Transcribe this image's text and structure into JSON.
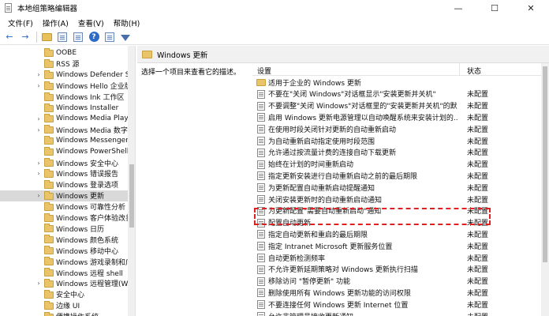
{
  "window": {
    "title": "本地组策略编辑器",
    "controls": [
      "—",
      "☐",
      "✕"
    ]
  },
  "menubar": [
    "文件(F)",
    "操作(A)",
    "查看(V)",
    "帮助(H)"
  ],
  "toolbar": {
    "back_icon": "arrow-left",
    "forward_icon": "arrow-right",
    "help_glyph": "?"
  },
  "tree": {
    "items": [
      {
        "label": "OOBE",
        "expander": ""
      },
      {
        "label": "RSS 源",
        "expander": ""
      },
      {
        "label": "Windows Defender Sr",
        "expander": "›"
      },
      {
        "label": "Windows Hello 企业版",
        "expander": "›"
      },
      {
        "label": "Windows Ink 工作区",
        "expander": ""
      },
      {
        "label": "Windows Installer",
        "expander": ""
      },
      {
        "label": "Windows Media Playe",
        "expander": "›"
      },
      {
        "label": "Windows Media 数字",
        "expander": "›"
      },
      {
        "label": "Windows Messenger",
        "expander": ""
      },
      {
        "label": "Windows PowerShell",
        "expander": ""
      },
      {
        "label": "Windows 安全中心",
        "expander": "›"
      },
      {
        "label": "Windows 错误报告",
        "expander": "›"
      },
      {
        "label": "Windows 登录选项",
        "expander": ""
      },
      {
        "label": "Windows 更新",
        "expander": "›"
      },
      {
        "label": "Windows 可靠性分析",
        "expander": ""
      },
      {
        "label": "Windows 客户体验改善",
        "expander": ""
      },
      {
        "label": "Windows 日历",
        "expander": ""
      },
      {
        "label": "Windows 颜色系统",
        "expander": ""
      },
      {
        "label": "Windows 移动中心",
        "expander": ""
      },
      {
        "label": "Windows 游戏录制和广",
        "expander": ""
      },
      {
        "label": "Windows 远程 shell",
        "expander": ""
      },
      {
        "label": "Windows 远程管理(Wi",
        "expander": "›"
      },
      {
        "label": "安全中心",
        "expander": ""
      },
      {
        "label": "边缘 UI",
        "expander": ""
      },
      {
        "label": "便携操作系统",
        "expander": ""
      }
    ],
    "selected_index": 13
  },
  "breadcrumb": {
    "title": "Windows 更新"
  },
  "description": {
    "text": "选择一个项目来查看它的描述。"
  },
  "list": {
    "col_setting": "设置",
    "col_state": "状态",
    "rows": [
      {
        "name": "适用于企业的 Windows 更新",
        "state": "",
        "type": "folder"
      },
      {
        "name": "不要在\"关闭 Windows\"对话框显示\"安装更新并关机\"",
        "state": "未配置",
        "type": "policy"
      },
      {
        "name": "不要调整\"关闭 Windows\"对话框里的\"安装更新并关机\"的默...",
        "state": "未配置",
        "type": "policy"
      },
      {
        "name": "启用 Windows 更新电源管理以自动唤醒系统来安装计划的...",
        "state": "未配置",
        "type": "policy"
      },
      {
        "name": "在使用时段关闭针对更新的自动重新启动",
        "state": "未配置",
        "type": "policy"
      },
      {
        "name": "为自动重新启动指定使用时段范围",
        "state": "未配置",
        "type": "policy"
      },
      {
        "name": "允许通过按流量计费的连接自动下载更新",
        "state": "未配置",
        "type": "policy"
      },
      {
        "name": "始终在计划的时间重新启动",
        "state": "未配置",
        "type": "policy"
      },
      {
        "name": "指定更新安装进行自动重新启动之前的最后期限",
        "state": "未配置",
        "type": "policy"
      },
      {
        "name": "为更新配置自动重新启动提醒通知",
        "state": "未配置",
        "type": "policy"
      },
      {
        "name": "关闭安装更新时的自动重新启动通知",
        "state": "未配置",
        "type": "policy"
      },
      {
        "name": "为更新配置\"需要自动重新启动\"通知",
        "state": "未配置",
        "type": "policy"
      },
      {
        "name": "配置自动更新",
        "state": "未配置",
        "type": "policy"
      },
      {
        "name": "指定自动更新和重启的最后期限",
        "state": "未配置",
        "type": "policy"
      },
      {
        "name": "指定 Intranet Microsoft 更新服务位置",
        "state": "未配置",
        "type": "policy"
      },
      {
        "name": "自动更新检测频率",
        "state": "未配置",
        "type": "policy"
      },
      {
        "name": "不允许更新延期策略对 Windows 更新执行扫描",
        "state": "未配置",
        "type": "policy"
      },
      {
        "name": "移除访问 \"暂停更新\" 功能",
        "state": "未配置",
        "type": "policy"
      },
      {
        "name": "删除使用所有 Windows 更新功能的访问权限",
        "state": "未配置",
        "type": "policy"
      },
      {
        "name": "不要连接任何 Windows 更新 Internet 位置",
        "state": "未配置",
        "type": "policy"
      },
      {
        "name": "允许非管理员接收更新通知",
        "state": "未配置",
        "type": "policy"
      }
    ],
    "highlighted_index": 12,
    "highlight_color": "#e02020"
  }
}
